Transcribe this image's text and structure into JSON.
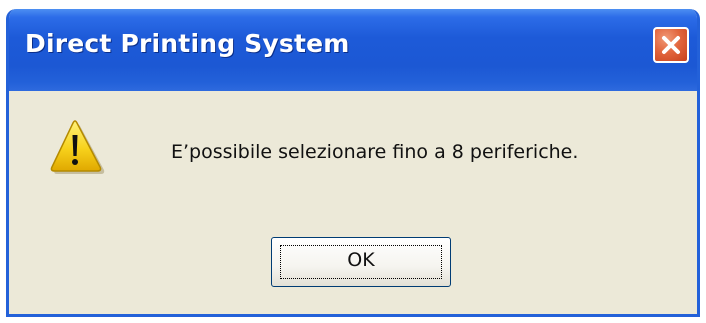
{
  "window": {
    "title": "Direct Printing System",
    "close_icon": "close-icon"
  },
  "dialog": {
    "icon": "warning-icon",
    "message": "E’possibile selezionare fino a 8 periferiche.",
    "ok_label": "OK"
  },
  "colors": {
    "titlebar": "#1d5ad8",
    "close_button": "#e2663e",
    "body": "#ece9d8",
    "warning_yellow": "#f7d21c"
  }
}
